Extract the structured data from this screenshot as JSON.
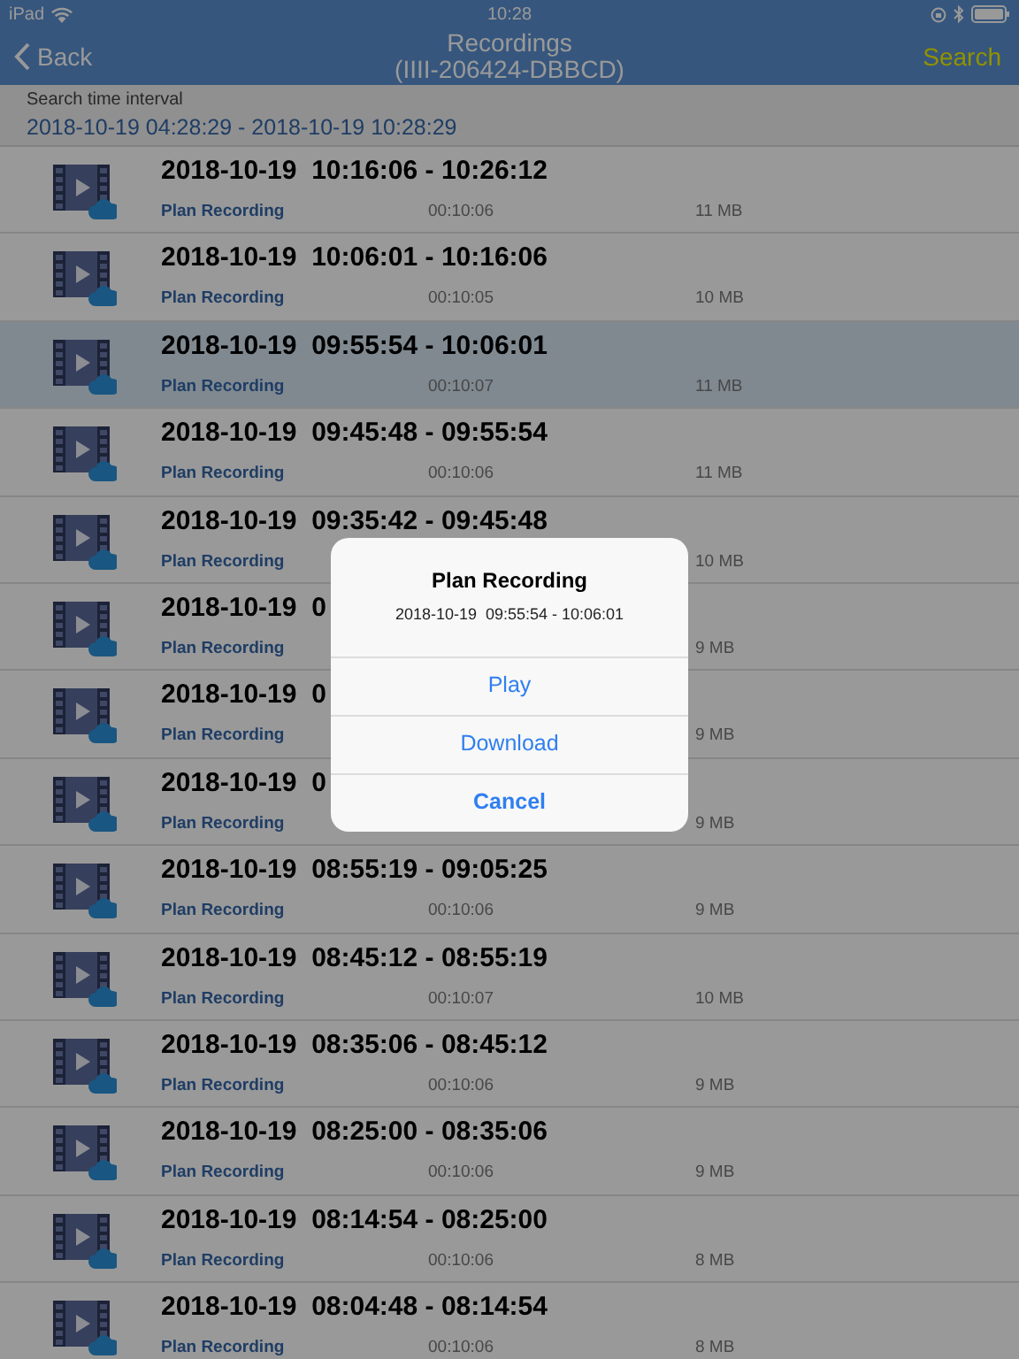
{
  "status_bar": {
    "device": "iPad",
    "time": "10:28"
  },
  "nav": {
    "back": "Back",
    "title": "Recordings",
    "subtitle": "(IIII-206424-DBBCD)",
    "action": "Search"
  },
  "interval": {
    "label": "Search time interval",
    "value": "2018-10-19 04:28:29 - 2018-10-19 10:28:29"
  },
  "recordings": [
    {
      "title": "2018-10-19  10:16:06 - 10:26:12",
      "type": "Plan Recording",
      "duration": "00:10:06",
      "size": "11 MB",
      "selected": false
    },
    {
      "title": "2018-10-19  10:06:01 - 10:16:06",
      "type": "Plan Recording",
      "duration": "00:10:05",
      "size": "10 MB",
      "selected": false
    },
    {
      "title": "2018-10-19  09:55:54 - 10:06:01",
      "type": "Plan Recording",
      "duration": "00:10:07",
      "size": "11 MB",
      "selected": true
    },
    {
      "title": "2018-10-19  09:45:48 - 09:55:54",
      "type": "Plan Recording",
      "duration": "00:10:06",
      "size": "11 MB",
      "selected": false
    },
    {
      "title": "2018-10-19  09:35:42 - 09:45:48",
      "type": "Plan Recording",
      "size": "10 MB",
      "selected": false
    },
    {
      "title": "2018-10-19  0",
      "type": "Plan Recording",
      "size": "9 MB",
      "selected": false
    },
    {
      "title": "2018-10-19  0",
      "type": "Plan Recording",
      "size": "9 MB",
      "selected": false
    },
    {
      "title": "2018-10-19  0",
      "type": "Plan Recording",
      "size": "9 MB",
      "selected": false
    },
    {
      "title": "2018-10-19  08:55:19 - 09:05:25",
      "type": "Plan Recording",
      "duration": "00:10:06",
      "size": "9 MB",
      "selected": false
    },
    {
      "title": "2018-10-19  08:45:12 - 08:55:19",
      "type": "Plan Recording",
      "duration": "00:10:07",
      "size": "10 MB",
      "selected": false
    },
    {
      "title": "2018-10-19  08:35:06 - 08:45:12",
      "type": "Plan Recording",
      "duration": "00:10:06",
      "size": "9 MB",
      "selected": false
    },
    {
      "title": "2018-10-19  08:25:00 - 08:35:06",
      "type": "Plan Recording",
      "duration": "00:10:06",
      "size": "9 MB",
      "selected": false
    },
    {
      "title": "2018-10-19  08:14:54 - 08:25:00",
      "type": "Plan Recording",
      "duration": "00:10:06",
      "size": "8 MB",
      "selected": false
    },
    {
      "title": "2018-10-19  08:04:48 - 08:14:54",
      "type": "Plan Recording",
      "duration": "00:10:06",
      "size": "8 MB",
      "selected": false
    }
  ],
  "dialog": {
    "title": "Plan Recording",
    "subtitle": "2018-10-19  09:55:54 - 10:06:01",
    "actions": [
      {
        "label": "Play",
        "kind": "default"
      },
      {
        "label": "Download",
        "kind": "default"
      },
      {
        "label": "Cancel",
        "kind": "cancel"
      }
    ]
  }
}
